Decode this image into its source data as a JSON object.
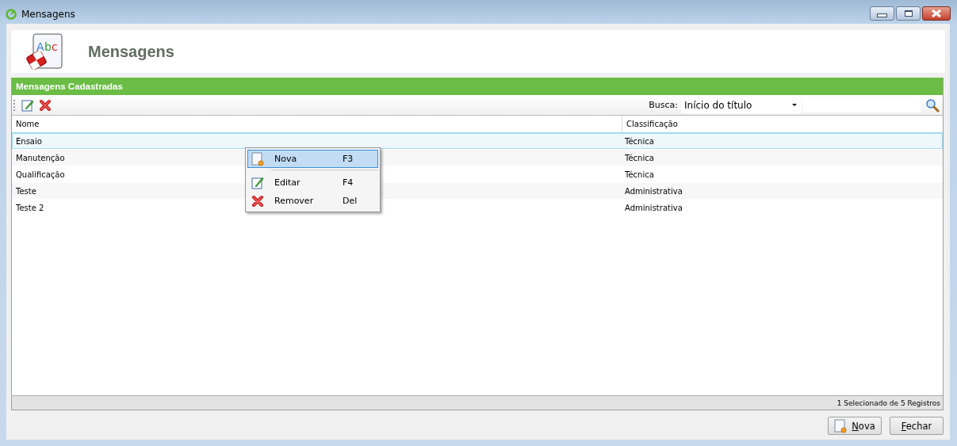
{
  "window": {
    "title": "Mensagens"
  },
  "header": {
    "title": "Mensagens",
    "icon_letters": [
      "A",
      "b",
      "c"
    ]
  },
  "panel": {
    "title": "Mensagens Cadastradas"
  },
  "search": {
    "label": "Busca:",
    "mode": "Início do título"
  },
  "table": {
    "columns": [
      "Nome",
      "Classificação"
    ],
    "rows": [
      {
        "cells": [
          "Ensaio",
          "Técnica"
        ],
        "selected": true
      },
      {
        "cells": [
          "Manutenção",
          "Técnica"
        ],
        "selected": false
      },
      {
        "cells": [
          "Qualificação",
          "Técnica"
        ],
        "selected": false
      },
      {
        "cells": [
          "Teste",
          "Administrativa"
        ],
        "selected": false
      },
      {
        "cells": [
          "Teste 2",
          "Administrativa"
        ],
        "selected": false
      }
    ]
  },
  "context_menu": [
    {
      "kind": "new",
      "label": "Nova",
      "shortcut": "F3",
      "selected": true
    },
    {
      "kind": "edit",
      "label": "Editar",
      "shortcut": "F4",
      "selected": false
    },
    {
      "kind": "remove",
      "label": "Remover",
      "shortcut": "Del",
      "selected": false
    }
  ],
  "status_bar": "1 Selecionado de 5 Registros",
  "buttons": [
    {
      "kind": "new",
      "label": "Nova"
    },
    {
      "kind": "close",
      "label": "Fechar"
    }
  ]
}
